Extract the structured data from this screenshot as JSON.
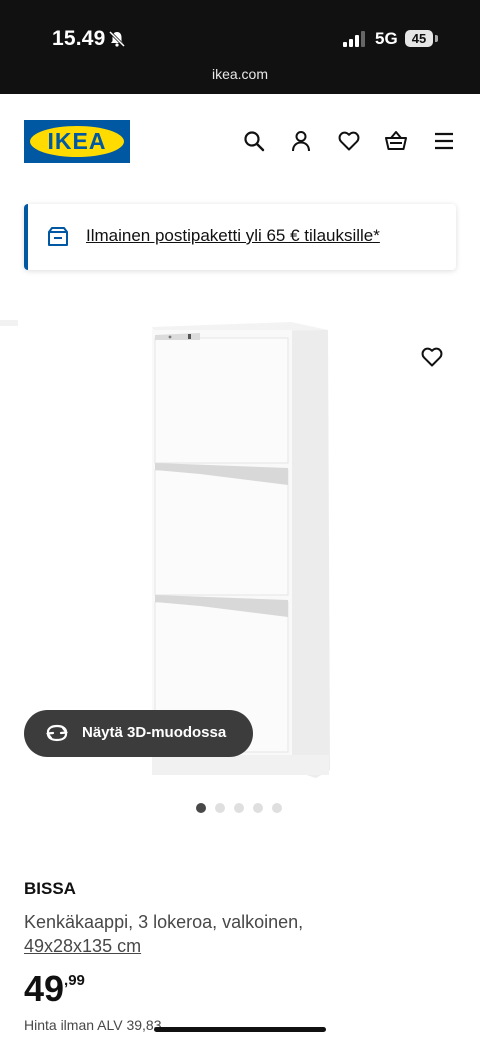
{
  "status_bar": {
    "time": "15.49",
    "network": "5G",
    "battery": "45",
    "url": "ikea.com"
  },
  "header": {
    "logo_text": "IKEA",
    "icons": [
      "search-icon",
      "account-icon",
      "wishlist-icon",
      "cart-icon",
      "menu-icon"
    ]
  },
  "banner": {
    "icon": "delivery-icon",
    "text": "Ilmainen postipaketti yli 65 € tilauksille*"
  },
  "gallery": {
    "view_3d_label": "Näytä 3D-muodossa",
    "image_count": 5,
    "active_index": 0
  },
  "product": {
    "name": "BISSA",
    "description": "Kenkäkaappi, 3 lokeroa, valkoinen,",
    "size": "49x28x135 cm",
    "price_int": "49",
    "price_dec": ",99",
    "price_note": "Hinta ilman ALV 39,83"
  },
  "colors": {
    "brand_blue": "#0058a3",
    "brand_yellow": "#ffdb00",
    "status_bar": "#111111"
  }
}
